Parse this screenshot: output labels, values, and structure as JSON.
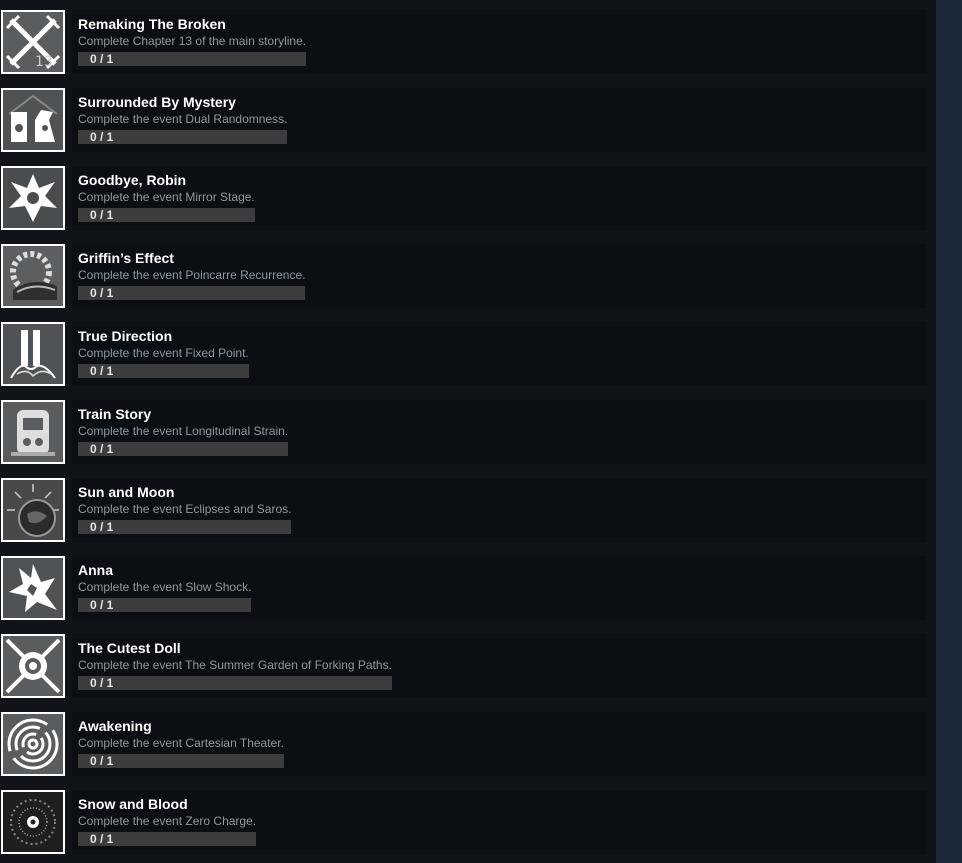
{
  "achievements": [
    {
      "title": "Remaking The Broken",
      "description": "Complete Chapter 13 of the main storyline.",
      "progress_text": "0 / 1",
      "progress_fraction": 0,
      "icon": "crossed-swords-13-icon"
    },
    {
      "title": "Surrounded By Mystery",
      "description": "Complete the event Dual Randomness.",
      "progress_text": "0 / 1",
      "progress_fraction": 0,
      "icon": "chess-pieces-icon"
    },
    {
      "title": "Goodbye, Robin",
      "description": "Complete the event Mirror Stage.",
      "progress_text": "0 / 1",
      "progress_fraction": 0,
      "icon": "mirrored-bird-icon"
    },
    {
      "title": "Griffin’s Effect",
      "description": "Complete the event Poincarre Recurrence.",
      "progress_text": "0 / 1",
      "progress_fraction": 0,
      "icon": "gear-griffin-icon"
    },
    {
      "title": "True Direction",
      "description": "Complete the event Fixed Point.",
      "progress_text": "0 / 1",
      "progress_fraction": 0,
      "icon": "pillars-roots-icon"
    },
    {
      "title": "Train Story",
      "description": "Complete the event Longitudinal Strain.",
      "progress_text": "0 / 1",
      "progress_fraction": 0,
      "icon": "train-robot-icon"
    },
    {
      "title": "Sun and Moon",
      "description": "Complete the event Eclipses and Saros.",
      "progress_text": "0 / 1",
      "progress_fraction": 0,
      "icon": "sun-moon-icon"
    },
    {
      "title": "Anna",
      "description": "Complete the event Slow Shock.",
      "progress_text": "0 / 1",
      "progress_fraction": 0,
      "icon": "shards-icon"
    },
    {
      "title": "The Cutest Doll",
      "description": "Complete the event The Summer Garden of Forking Paths.",
      "progress_text": "0 / 1",
      "progress_fraction": 0,
      "icon": "doll-eye-icon"
    },
    {
      "title": "Awakening",
      "description": "Complete the event Cartesian Theater.",
      "progress_text": "0 / 1",
      "progress_fraction": 0,
      "icon": "labyrinth-icon"
    },
    {
      "title": "Snow and Blood",
      "description": "Complete the event Zero Charge.",
      "progress_text": "0 / 1",
      "progress_fraction": 0,
      "icon": "snow-eye-icon"
    }
  ],
  "colors": {
    "page_background": "#101419",
    "card_background": "#0b0e12",
    "side_strip": "#1b2838",
    "title_text": "#ffffff",
    "description_text": "#8f98a0",
    "progress_track": "#3d3d3d"
  }
}
